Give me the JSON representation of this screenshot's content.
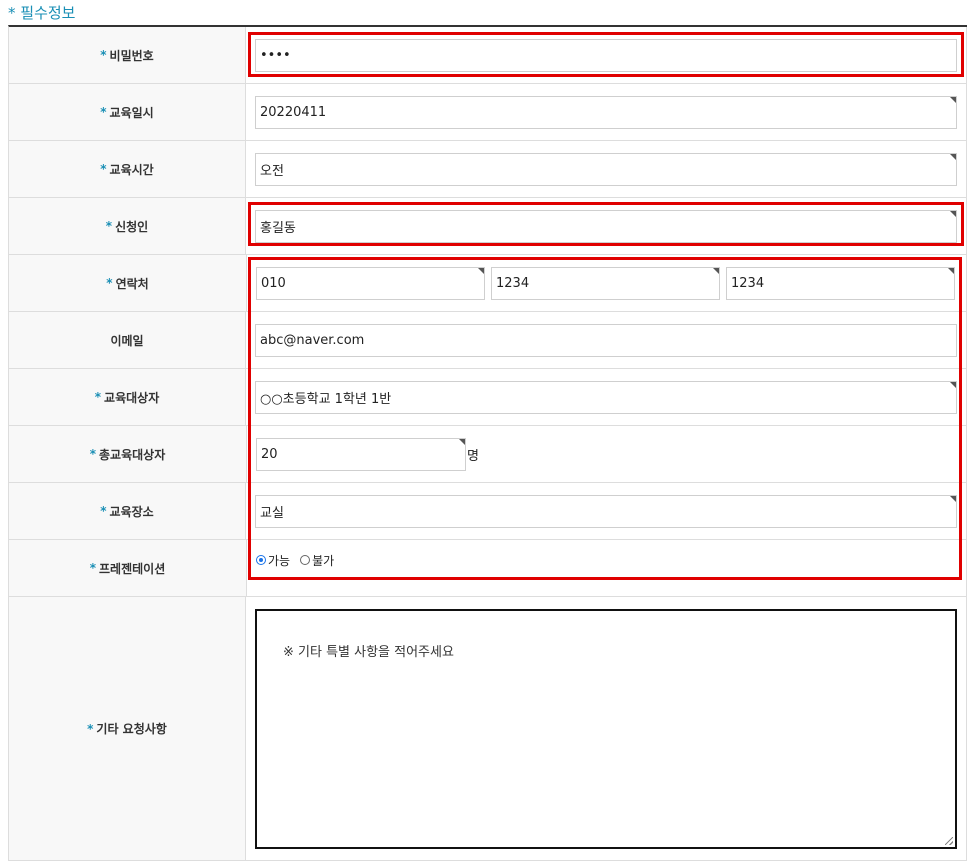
{
  "section_title": "* 필수정보",
  "required_star": "*",
  "fields": {
    "password": {
      "label": "비밀번호",
      "value": "••••"
    },
    "edu_date": {
      "label": "교육일시",
      "value": "20220411"
    },
    "edu_time": {
      "label": "교육시간",
      "value": "오전"
    },
    "applicant": {
      "label": "신청인",
      "value": "홍길동"
    },
    "contact": {
      "label": "연락처",
      "parts": [
        "010",
        "1234",
        "1234"
      ]
    },
    "email": {
      "label": "이메일",
      "value": "abc@naver.com"
    },
    "edu_target": {
      "label": "교육대상자",
      "value": "○○초등학교 1학년 1반"
    },
    "total_target": {
      "label": "총교육대상자",
      "value": "20",
      "unit": "명"
    },
    "edu_place": {
      "label": "교육장소",
      "value": "교실"
    },
    "presentation": {
      "label": "프레젠테이션",
      "options": [
        "가능",
        "불가"
      ],
      "selected": "가능"
    },
    "other_request": {
      "label": "기타 요청사항",
      "placeholder": "※ 기타 특별 사항을 적어주세요"
    }
  },
  "colors": {
    "accent": "#1a8fb5",
    "highlight": "#e00000",
    "radio_selected": "#1a73e8"
  }
}
